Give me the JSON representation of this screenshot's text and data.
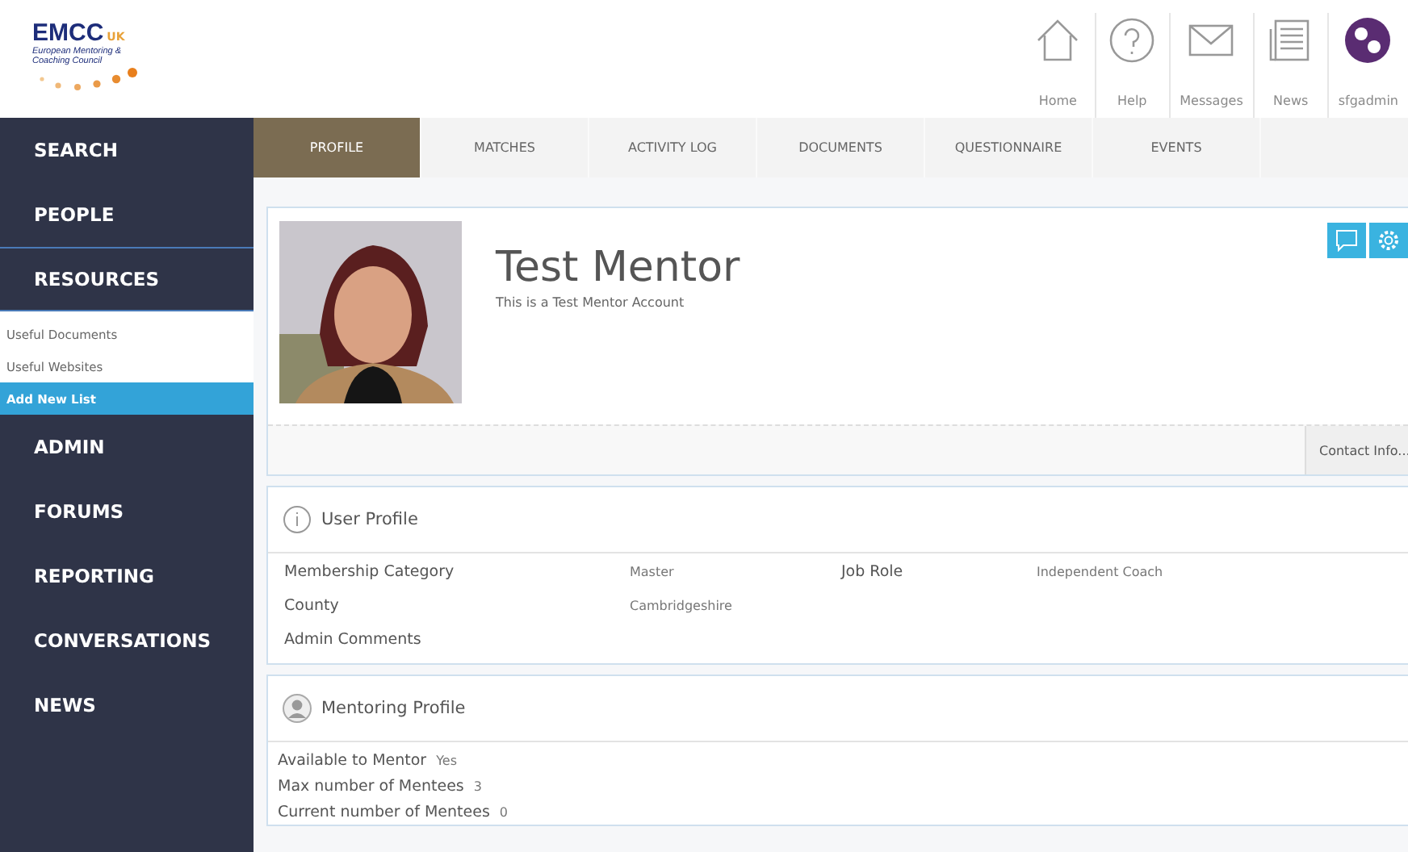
{
  "header": {
    "logo": {
      "name": "EMCC",
      "suffix": "UK",
      "tagline": "European Mentoring & Coaching Council"
    },
    "icons": [
      {
        "label": "Home",
        "kind": "home"
      },
      {
        "label": "Help",
        "kind": "help"
      },
      {
        "label": "Messages",
        "kind": "messages"
      },
      {
        "label": "News",
        "kind": "news"
      }
    ],
    "user": {
      "name": "sfgadmin"
    }
  },
  "sidebar": {
    "items": [
      {
        "label": "SEARCH",
        "expanded": false
      },
      {
        "label": "PEOPLE",
        "expanded": false
      },
      {
        "label": "RESOURCES",
        "expanded": true,
        "children": [
          {
            "label": "Useful Documents",
            "selected": false
          },
          {
            "label": "Useful Websites",
            "selected": false
          },
          {
            "label": "Add New List",
            "selected": true
          }
        ]
      },
      {
        "label": "ADMIN",
        "expanded": false
      },
      {
        "label": "FORUMS",
        "expanded": false
      },
      {
        "label": "REPORTING",
        "expanded": false
      },
      {
        "label": "CONVERSATIONS",
        "expanded": false
      },
      {
        "label": "NEWS",
        "expanded": false
      }
    ]
  },
  "tabs": [
    {
      "label": "PROFILE",
      "selected": true
    },
    {
      "label": "MATCHES",
      "selected": false
    },
    {
      "label": "ACTIVITY LOG",
      "selected": false
    },
    {
      "label": "DOCUMENTS",
      "selected": false
    },
    {
      "label": "QUESTIONNAIRE",
      "selected": false
    },
    {
      "label": "EVENTS",
      "selected": false
    }
  ],
  "profile": {
    "name": "Test Mentor",
    "subtitle": "This is a Test Mentor Account",
    "actions": [
      {
        "kind": "chat"
      },
      {
        "kind": "settings"
      }
    ],
    "contact_button": "Contact Info..."
  },
  "user_profile": {
    "title": "User Profile",
    "rows": [
      [
        {
          "label": "Membership Category",
          "value": "Master"
        },
        {
          "label": "Job Role",
          "value": "Independent Coach"
        }
      ],
      [
        {
          "label": "County",
          "value": "Cambridgeshire"
        }
      ],
      [
        {
          "label": "Admin Comments"
        }
      ]
    ]
  },
  "mentoring_profile": {
    "title": "Mentoring Profile",
    "fields": [
      {
        "label": "Available to Mentor",
        "value": "Yes"
      },
      {
        "label": "Max number of Mentees",
        "value": "3"
      },
      {
        "label": "Current number of Mentees",
        "value": "0"
      }
    ]
  }
}
